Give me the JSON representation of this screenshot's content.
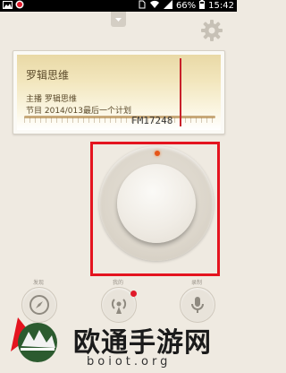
{
  "status_bar": {
    "battery_percent": "66%",
    "time": "15:42",
    "icons": [
      "gallery-icon",
      "record-icon",
      "sim-icon",
      "wifi-icon",
      "signal-icon",
      "battery-icon"
    ]
  },
  "header": {
    "settings_icon": "gear-icon"
  },
  "station": {
    "title": "罗辑思维",
    "host_line": "主播 罗辑思维",
    "program_line": "节目 2014/013最后一个计划",
    "frequency": "FM17248"
  },
  "knob": {
    "indicator_color": "#e5561a"
  },
  "highlight_color": "#e4141f",
  "bottom_nav": [
    {
      "label": "发现",
      "icon": "compass-icon"
    },
    {
      "label": "我的",
      "icon": "broadcast-icon"
    },
    {
      "label": "录制",
      "icon": "mic-icon"
    }
  ],
  "watermark": {
    "name": "欧通手游网",
    "domain": "boiot.org"
  }
}
